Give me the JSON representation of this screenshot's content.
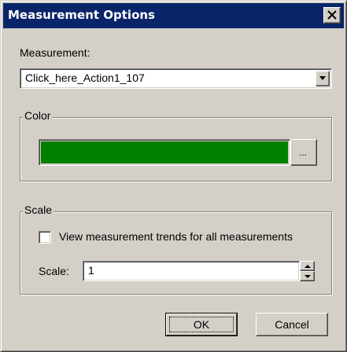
{
  "window": {
    "title": "Measurement Options"
  },
  "measurement": {
    "label": "Measurement:",
    "selected": "Click_here_Action1_107"
  },
  "color_group": {
    "title": "Color",
    "swatch_color": "#008000",
    "browse_label": "..."
  },
  "scale_group": {
    "title": "Scale",
    "checkbox_label": "View measurement trends for all measurements",
    "checkbox_checked": false,
    "scale_label": "Scale:",
    "scale_value": "1"
  },
  "buttons": {
    "ok_label": "OK",
    "cancel_label": "Cancel"
  }
}
